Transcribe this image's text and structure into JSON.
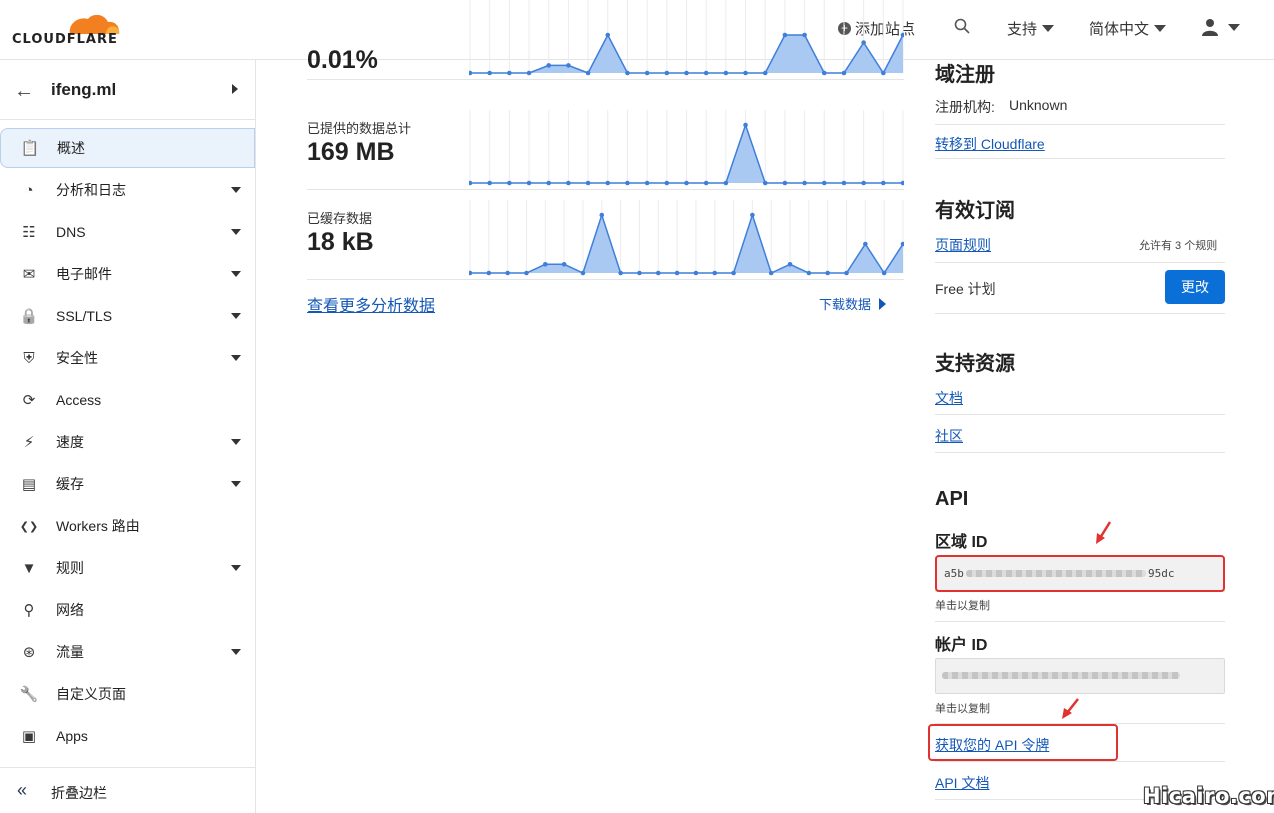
{
  "header": {
    "logo_text": "CLOUDFLARE",
    "add_site": "添加站点",
    "support": "支持",
    "language": "简体中文"
  },
  "sidebar": {
    "site_name": "ifeng.ml",
    "items": [
      {
        "label": "概述",
        "icon": "clipboard-icon",
        "active": true
      },
      {
        "label": "分析和日志",
        "icon": "pie-chart-icon",
        "has_caret": true
      },
      {
        "label": "DNS",
        "icon": "network-icon",
        "has_caret": true
      },
      {
        "label": "电子邮件",
        "icon": "mail-icon",
        "has_caret": true
      },
      {
        "label": "SSL/TLS",
        "icon": "lock-icon",
        "has_caret": true
      },
      {
        "label": "安全性",
        "icon": "shield-icon",
        "has_caret": true
      },
      {
        "label": "Access",
        "icon": "access-icon"
      },
      {
        "label": "速度",
        "icon": "lightning-icon",
        "has_caret": true
      },
      {
        "label": "缓存",
        "icon": "cache-icon",
        "has_caret": true
      },
      {
        "label": "Workers 路由",
        "icon": "workers-icon"
      },
      {
        "label": "规则",
        "icon": "rules-icon",
        "has_caret": true
      },
      {
        "label": "网络",
        "icon": "location-icon"
      },
      {
        "label": "流量",
        "icon": "traffic-icon",
        "has_caret": true
      },
      {
        "label": "自定义页面",
        "icon": "wrench-icon"
      },
      {
        "label": "Apps",
        "icon": "apps-icon"
      }
    ],
    "collapse_label": "折叠边栏"
  },
  "analytics": {
    "metrics": [
      {
        "label": "",
        "value": "0.01%",
        "series": [
          0,
          0,
          0,
          0,
          0.2,
          0.2,
          0,
          1,
          0,
          0,
          0,
          0,
          0,
          0,
          0,
          0,
          1,
          1,
          0,
          0,
          0.8,
          0,
          1
        ]
      },
      {
        "label": "已提供的数据总计",
        "value": "169 MB",
        "series": [
          0,
          0,
          0,
          0,
          0,
          0,
          0,
          0,
          0,
          0,
          0,
          0,
          0,
          0,
          1,
          0,
          0,
          0,
          0,
          0,
          0,
          0,
          0
        ]
      },
      {
        "label": "已缓存数据",
        "value": "18 kB",
        "series": [
          0,
          0,
          0,
          0,
          0.15,
          0.15,
          0,
          1,
          0,
          0,
          0,
          0,
          0,
          0,
          0,
          1,
          0,
          0.15,
          0,
          0,
          0,
          0.5,
          0,
          0.5
        ]
      }
    ],
    "more_link": "查看更多分析数据",
    "download_link": "下载数据"
  },
  "domain_registration": {
    "title": "域注册",
    "registrar_label": "注册机构:",
    "registrar_value": "Unknown",
    "transfer_link": "转移到 Cloudflare"
  },
  "subscription": {
    "title": "有效订阅",
    "page_rules_link": "页面规则",
    "page_rules_allowance": "允许有 3 个规则",
    "plan": "Free 计划",
    "change_button": "更改"
  },
  "resources": {
    "title": "支持资源",
    "docs_link": "文档",
    "community_link": "社区"
  },
  "api": {
    "title": "API",
    "zone_id_label": "区域 ID",
    "zone_id_prefix": "a5b",
    "zone_id_suffix": "95dc",
    "click_to_copy": "单击以复制",
    "account_id_label": "帐户 ID",
    "click_to_copy_2": "单击以复制",
    "token_link": "获取您的 API 令牌",
    "docs_link": "API 文档"
  },
  "watermark": "Hicairo.com",
  "colors": {
    "accent_blue": "#0b6fd8",
    "chart_fill": "#a9c8f2",
    "chart_line": "#3f7fd9",
    "annotation_red": "#e0322e",
    "logo_orange": "#f38020"
  }
}
